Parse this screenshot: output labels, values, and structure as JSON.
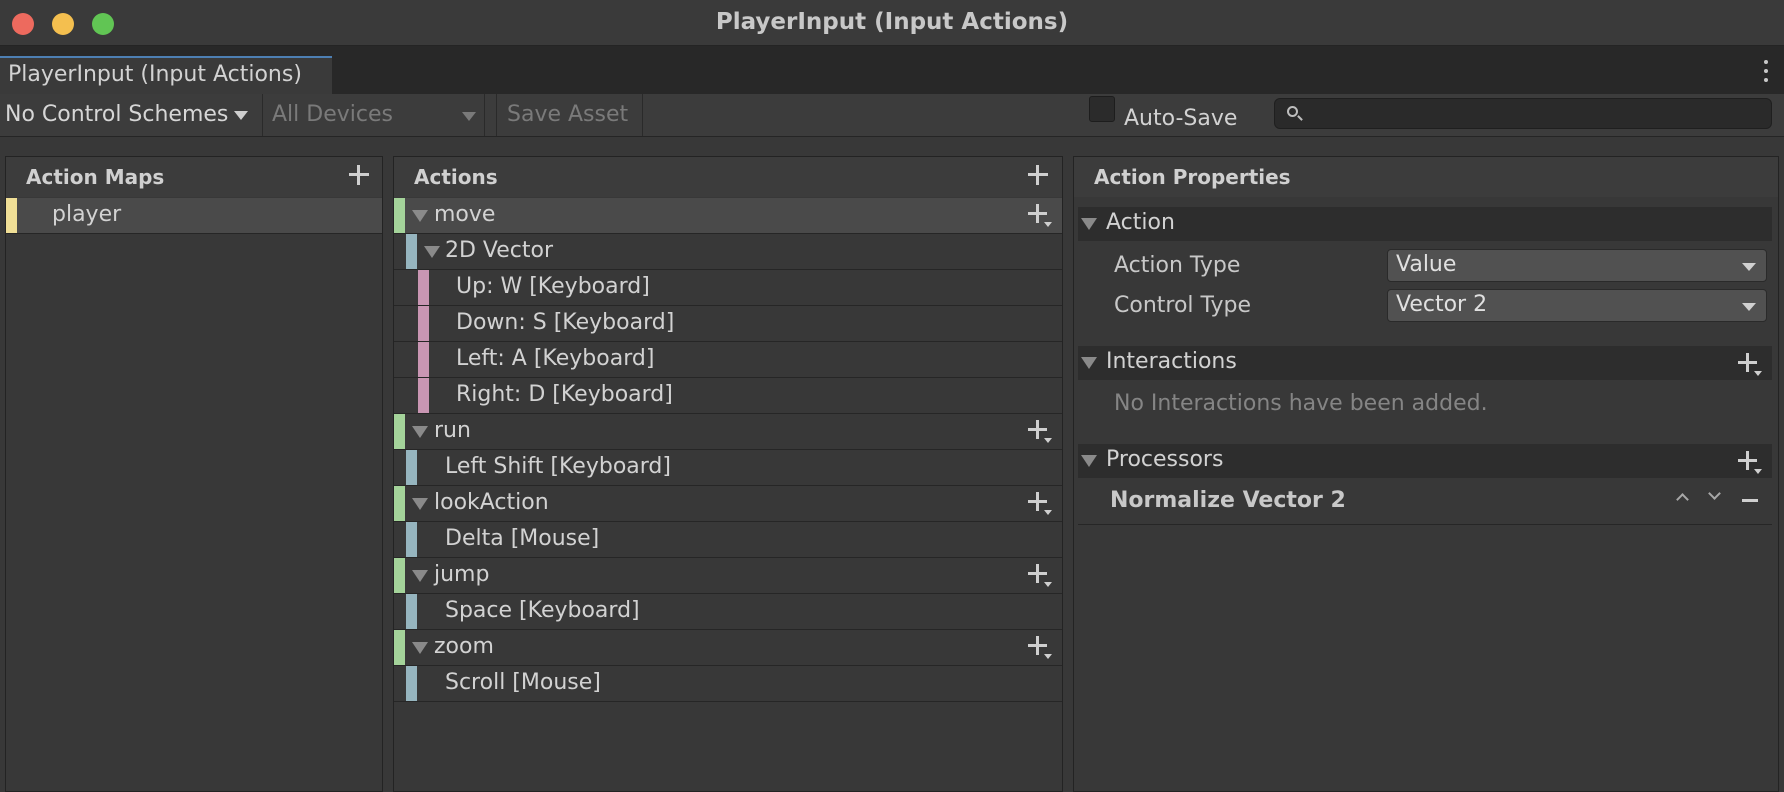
{
  "window": {
    "title": "PlayerInput (Input Actions)",
    "tab_label": "PlayerInput (Input Actions)"
  },
  "toolbar": {
    "control_schemes": "No Control Schemes",
    "devices": "All Devices",
    "save_asset": "Save Asset",
    "auto_save": "Auto-Save",
    "auto_save_checked": false,
    "search_value": ""
  },
  "action_maps": {
    "title": "Action Maps",
    "items": [
      {
        "label": "player",
        "selected": true
      }
    ]
  },
  "actions": {
    "title": "Actions",
    "items": [
      {
        "kind": "action",
        "label": "move"
      },
      {
        "kind": "composite",
        "label": "2D Vector"
      },
      {
        "kind": "part",
        "label": "Up: W [Keyboard]"
      },
      {
        "kind": "part",
        "label": "Down: S [Keyboard]"
      },
      {
        "kind": "part",
        "label": "Left: A [Keyboard]"
      },
      {
        "kind": "part",
        "label": "Right: D [Keyboard]"
      },
      {
        "kind": "action",
        "label": "run"
      },
      {
        "kind": "binding",
        "label": "Left Shift [Keyboard]"
      },
      {
        "kind": "action",
        "label": "lookAction"
      },
      {
        "kind": "binding",
        "label": "Delta [Mouse]"
      },
      {
        "kind": "action",
        "label": "jump"
      },
      {
        "kind": "binding",
        "label": "Space [Keyboard]"
      },
      {
        "kind": "action",
        "label": "zoom"
      },
      {
        "kind": "binding",
        "label": "Scroll [Mouse]"
      }
    ]
  },
  "properties": {
    "title": "Action Properties",
    "action_section": "Action",
    "action_type_label": "Action Type",
    "action_type_value": "Value",
    "control_type_label": "Control Type",
    "control_type_value": "Vector 2",
    "interactions_section": "Interactions",
    "interactions_empty": "No Interactions have been added.",
    "processors_section": "Processors",
    "processors": [
      "Normalize Vector 2"
    ]
  },
  "colors": {
    "action_map_marker": "#f0df96",
    "action_marker": "#a4d39a",
    "binding_marker": "#96b5bf",
    "part_marker": "#c996b3"
  }
}
